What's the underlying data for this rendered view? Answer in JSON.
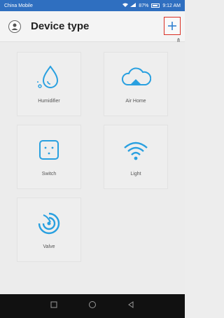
{
  "status": {
    "carrier": "China Mobile",
    "right_text": "87%",
    "time": "9:12 AM"
  },
  "header": {
    "title": "Device type"
  },
  "devices": [
    {
      "label": "Humidifier"
    },
    {
      "label": "Air Home"
    },
    {
      "label": "Switch"
    },
    {
      "label": "Light"
    },
    {
      "label": "Valve"
    }
  ],
  "colors": {
    "accent": "#29a0e0",
    "status_bar": "#2f6fc0",
    "highlight_border": "#d93025"
  }
}
